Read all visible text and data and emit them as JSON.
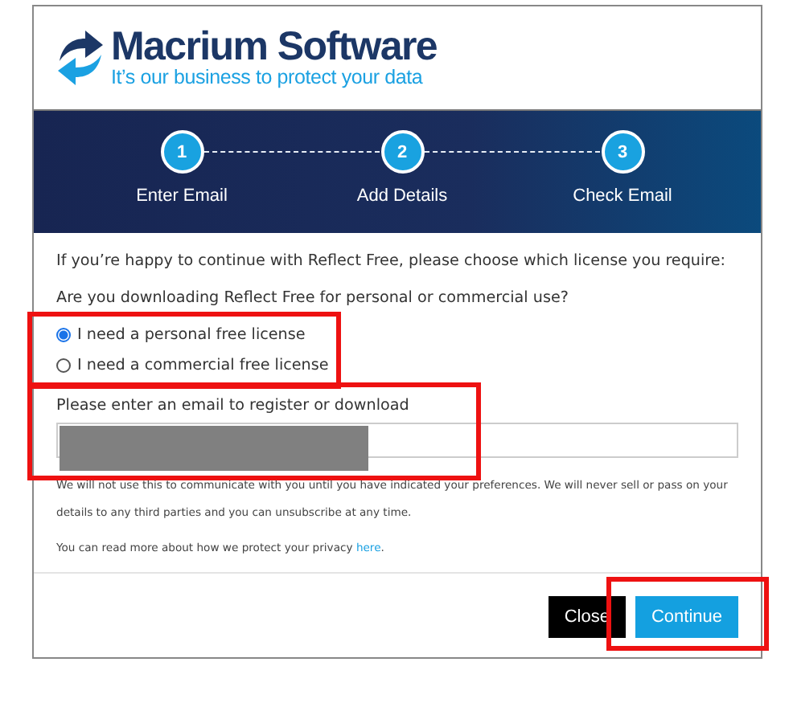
{
  "logo": {
    "name": "Macrium Software",
    "tagline": "It’s our business to protect your data"
  },
  "steps": [
    {
      "number": "1",
      "label": "Enter Email"
    },
    {
      "number": "2",
      "label": "Add Details"
    },
    {
      "number": "3",
      "label": "Check Email"
    }
  ],
  "intro": "If you’re happy to continue with Reflect Free, please choose which license you require:",
  "question": "Are you downloading Reflect Free for personal or commercial use?",
  "license_options": {
    "highlighted": true,
    "options": [
      {
        "label": "I need a personal free license",
        "selected": true
      },
      {
        "label": "I need a commercial free license",
        "selected": false
      }
    ]
  },
  "email": {
    "highlighted": true,
    "label": "Please enter an email to register or download",
    "redacted": true
  },
  "notice": "We will not use this to communicate with you until you have indicated your preferences. We will never sell or pass on your details to any third parties and you can unsubscribe at any time.",
  "privacy": {
    "text": "You can read more about how we protect your privacy",
    "link": "here",
    "after": "."
  },
  "buttons": [
    {
      "label": "Close",
      "kind": "secondary",
      "highlighted": false
    },
    {
      "label": "Continue",
      "kind": "primary",
      "highlighted": true
    }
  ]
}
